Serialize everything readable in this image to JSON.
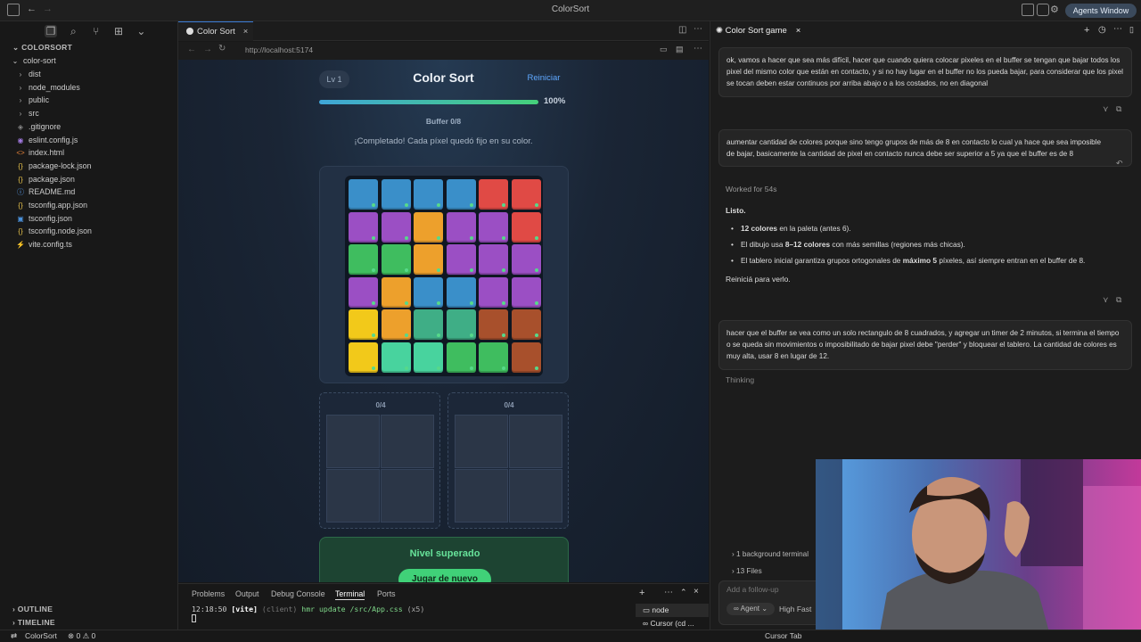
{
  "app": {
    "window_title": "ColorSort",
    "agents_button": "Agents Window"
  },
  "explorer": {
    "section": "COLORSORT",
    "root_folder": "color-sort",
    "items": [
      {
        "label": "dist",
        "icon": "chevron-right-icon"
      },
      {
        "label": "node_modules",
        "icon": "chevron-right-icon"
      },
      {
        "label": "public",
        "icon": "chevron-right-icon"
      },
      {
        "label": "src",
        "icon": "chevron-right-icon"
      },
      {
        "label": ".gitignore",
        "icon": "gitignore-icon"
      },
      {
        "label": "eslint.config.js",
        "icon": "eslint-icon"
      },
      {
        "label": "index.html",
        "icon": "html-icon"
      },
      {
        "label": "package-lock.json",
        "icon": "json-icon"
      },
      {
        "label": "package.json",
        "icon": "json-icon"
      },
      {
        "label": "README.md",
        "icon": "info-icon"
      },
      {
        "label": "tsconfig.app.json",
        "icon": "json-icon"
      },
      {
        "label": "tsconfig.json",
        "icon": "ts-config-icon"
      },
      {
        "label": "tsconfig.node.json",
        "icon": "json-icon"
      },
      {
        "label": "vite.config.ts",
        "icon": "vite-icon"
      }
    ],
    "outline": "OUTLINE",
    "timeline": "TIMELINE"
  },
  "editor": {
    "tab_label": "Color Sort",
    "url": "http://localhost:5174"
  },
  "game": {
    "level_badge": "Lv 1",
    "title": "Color Sort",
    "restart": "Reiniciar",
    "progress": 1.0,
    "progress_label": "100%",
    "buffer_label": "Buffer 0/8",
    "status": "¡Completado! Cada píxel quedó fijo en su color.",
    "palette": {
      "blue": "#3a8fc9",
      "red": "#e04a45",
      "purple": "#9b4fc4",
      "orange": "#eda02c",
      "green": "#3fbd5f",
      "yellow": "#f2c91a",
      "teal": "#3fae86",
      "mint": "#48d39e",
      "brown": "#a8502c"
    },
    "grid": [
      [
        "blue",
        "blue",
        "blue",
        "blue",
        "red",
        "red"
      ],
      [
        "purple",
        "purple",
        "orange",
        "purple",
        "purple",
        "red"
      ],
      [
        "green",
        "green",
        "orange",
        "purple",
        "purple",
        "purple"
      ],
      [
        "purple",
        "orange",
        "blue",
        "blue",
        "purple",
        "purple"
      ],
      [
        "yellow",
        "orange",
        "teal",
        "teal",
        "brown",
        "brown"
      ],
      [
        "yellow",
        "mint",
        "mint",
        "green",
        "green",
        "brown"
      ]
    ],
    "buffers": [
      {
        "count": "0/4"
      },
      {
        "count": "0/4"
      }
    ],
    "win_title": "Nivel superado",
    "play_again": "Jugar de nuevo"
  },
  "panel": {
    "tabs": [
      "Problems",
      "Output",
      "Debug Console",
      "Terminal",
      "Ports"
    ],
    "active_tab": "Terminal",
    "terminal_time": "12:18:50",
    "terminal_tag": "[vite]",
    "terminal_client": "(client)",
    "terminal_msg": "hmr update /src/App.css",
    "terminal_count": "(x5)",
    "sessions": [
      "node",
      "Cursor (cd ..."
    ]
  },
  "chat": {
    "tab_title": "Color Sort game",
    "msg1": "ok, vamos a hacer que sea más difícil, hacer que cuando quiera colocar pixeles en el buffer se tengan que bajar todos los pixel del mismo color que están en contacto, y si no hay lugar en el buffer no los pueda bajar, para considerar que los pixel se tocan deben estar continuos por arriba abajo o a los costados, no en diagonal",
    "msg2": "aumentar cantidad de colores porque sino tengo grupos de más de 8 en contacto lo cual ya hace que sea imposible de bajar, basicamente la cantidad de pixel en contacto nunca debe ser superior a 5 ya que el buffer es de 8",
    "worked": "Worked for 54s",
    "listo": "Listo.",
    "bullets": [
      {
        "bold": "12 colores",
        "rest": " en la paleta (antes 6)."
      },
      {
        "pre": "El dibujo usa ",
        "bold": "8–12 colores",
        "rest": " con más semillas (regiones más chicas)."
      },
      {
        "pre": "El tablero inicial garantiza grupos ortogonales de ",
        "bold": "máximo 5",
        "rest": " píxeles, así siempre entran en el buffer de 8."
      }
    ],
    "reinicia": "Reiniciá para verlo.",
    "msg3": "hacer que el buffer se vea como un solo rectangulo de 8 cuadrados, y agregar un timer de 2 minutos, si termina el tiempo o se queda sin movimientos o imposibilitado de bajar pixel debe \"perder\" y bloquear el tablero. La cantidad de colores es muy alta, usar 8 en lugar de 12.",
    "thinking": "Thinking",
    "bg_terminal": "1 background terminal",
    "files": "13 Files",
    "followup_placeholder": "Add a follow-up",
    "agent_mode": "Agent",
    "model": "High Fast"
  },
  "statusbar": {
    "project": "ColorSort",
    "problems": "⊗ 0 ⚠ 0",
    "cursor_tab": "Cursor Tab"
  }
}
